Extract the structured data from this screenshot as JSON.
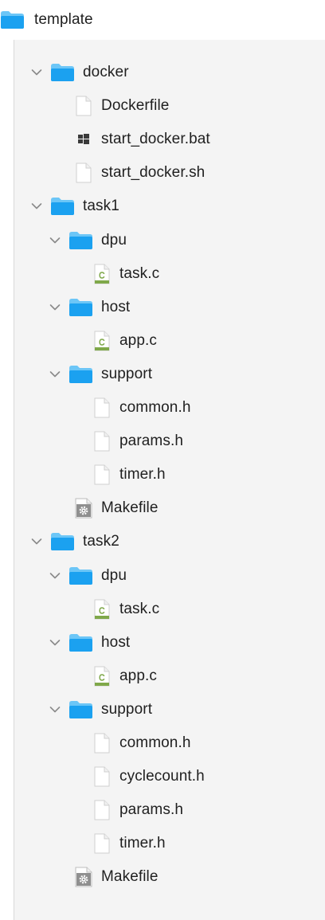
{
  "root": {
    "label": "template"
  },
  "tree": [
    {
      "label": "docker",
      "kind": "folder",
      "depth": 0
    },
    {
      "label": "Dockerfile",
      "kind": "file",
      "depth": 1
    },
    {
      "label": "start_docker.bat",
      "kind": "bat",
      "depth": 1
    },
    {
      "label": "start_docker.sh",
      "kind": "file",
      "depth": 1
    },
    {
      "label": "task1",
      "kind": "folder",
      "depth": 0
    },
    {
      "label": "dpu",
      "kind": "folder",
      "depth": 1
    },
    {
      "label": "task.c",
      "kind": "c",
      "depth": 2
    },
    {
      "label": "host",
      "kind": "folder",
      "depth": 1
    },
    {
      "label": "app.c",
      "kind": "c",
      "depth": 2
    },
    {
      "label": "support",
      "kind": "folder",
      "depth": 1
    },
    {
      "label": "common.h",
      "kind": "file",
      "depth": 2
    },
    {
      "label": "params.h",
      "kind": "file",
      "depth": 2
    },
    {
      "label": "timer.h",
      "kind": "file",
      "depth": 2
    },
    {
      "label": "Makefile",
      "kind": "makefile",
      "depth": 1
    },
    {
      "label": "task2",
      "kind": "folder",
      "depth": 0
    },
    {
      "label": "dpu",
      "kind": "folder",
      "depth": 1
    },
    {
      "label": "task.c",
      "kind": "c",
      "depth": 2
    },
    {
      "label": "host",
      "kind": "folder",
      "depth": 1
    },
    {
      "label": "app.c",
      "kind": "c",
      "depth": 2
    },
    {
      "label": "support",
      "kind": "folder",
      "depth": 1
    },
    {
      "label": "common.h",
      "kind": "file",
      "depth": 2
    },
    {
      "label": "cyclecount.h",
      "kind": "file",
      "depth": 2
    },
    {
      "label": "params.h",
      "kind": "file",
      "depth": 2
    },
    {
      "label": "timer.h",
      "kind": "file",
      "depth": 2
    },
    {
      "label": "Makefile",
      "kind": "makefile",
      "depth": 1
    }
  ],
  "colors": {
    "folder": "#1ba1f0",
    "folder_tab": "#6cc6f7",
    "chevron": "#8a8a8a",
    "c_badge": "#7fa84a"
  }
}
